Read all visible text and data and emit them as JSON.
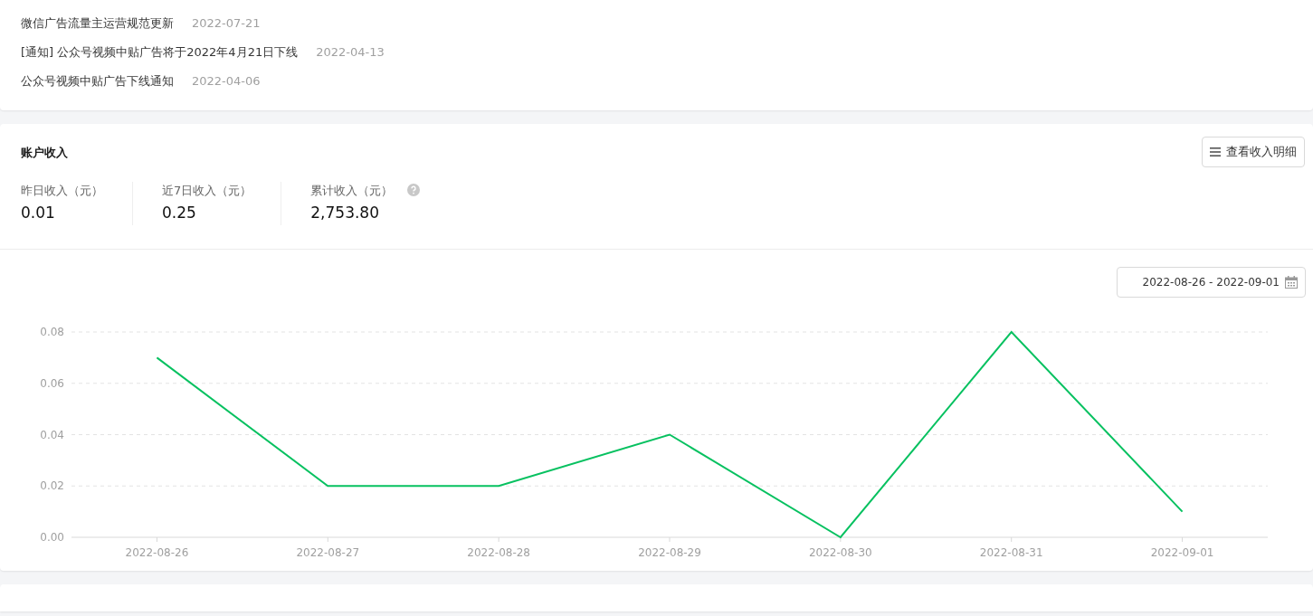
{
  "notices": [
    {
      "title": "微信广告流量主运营规范更新",
      "date": "2022-07-21"
    },
    {
      "title": "[通知] 公众号视频中贴广告将于2022年4月21日下线",
      "date": "2022-04-13"
    },
    {
      "title": "公众号视频中贴广告下线通知",
      "date": "2022-04-06"
    }
  ],
  "income": {
    "title": "账户收入",
    "detail_button": "查看收入明细",
    "stats": [
      {
        "label": "昨日收入（元）",
        "value": "0.01",
        "help": false
      },
      {
        "label": "近7日收入（元）",
        "value": "0.25",
        "help": false
      },
      {
        "label": "累计收入（元）",
        "value": "2,753.80",
        "help": true
      }
    ],
    "date_range": "2022-08-26 - 2022-09-01",
    "chart_data": {
      "type": "line",
      "categories": [
        "2022-08-26",
        "2022-08-27",
        "2022-08-28",
        "2022-08-29",
        "2022-08-30",
        "2022-08-31",
        "2022-09-01"
      ],
      "grid": true,
      "series": [
        {
          "color": "#07c160",
          "values": [
            0.07,
            0.02,
            0.02,
            0.04,
            0.0,
            0.08,
            0.01
          ]
        }
      ],
      "ylim": [
        0,
        0.08
      ],
      "yticks": [
        {
          "value": 0,
          "label": "0.00"
        },
        {
          "value": 0.02,
          "label": "0.02"
        },
        {
          "value": 0.04,
          "label": "0.04"
        },
        {
          "value": 0.06,
          "label": "0.06"
        },
        {
          "value": 0.08,
          "label": "0.08"
        }
      ]
    }
  }
}
